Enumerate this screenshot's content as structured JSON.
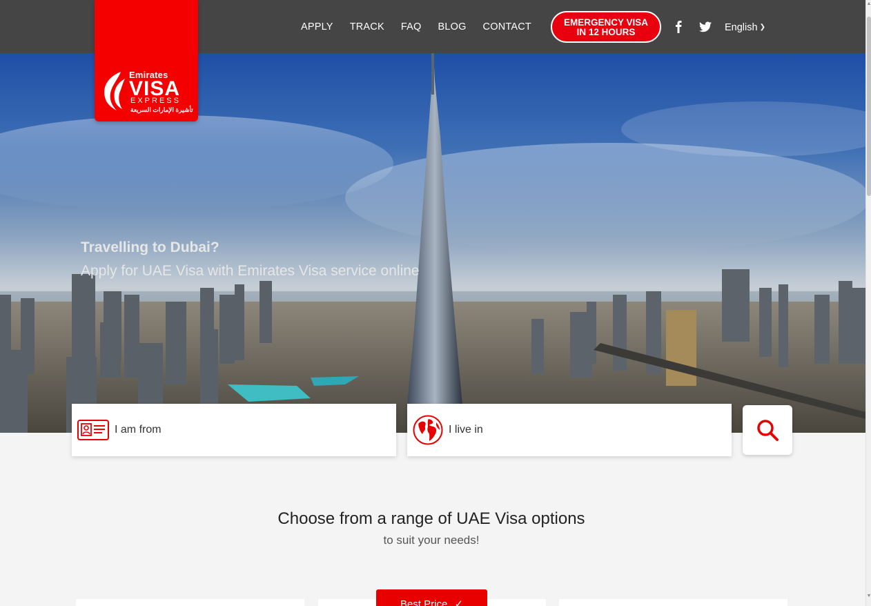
{
  "brand": {
    "logo_small": "Emirates",
    "logo_visa": "VISA",
    "logo_express": "EXPRESS",
    "logo_arabic": "تأشيرة الإمارات السريعة",
    "color": "#f40000"
  },
  "nav": {
    "items": [
      {
        "label": "APPLY"
      },
      {
        "label": "TRACK"
      },
      {
        "label": "FAQ"
      },
      {
        "label": "BLOG"
      },
      {
        "label": "CONTACT"
      }
    ],
    "emergency_line1": "EMERGENCY VISA",
    "emergency_line2": "IN 12 HOURS",
    "social": [
      "facebook-icon",
      "twitter-icon"
    ],
    "language": "English"
  },
  "hero": {
    "title": "Travelling to Dubai?",
    "subtitle": "Apply for UAE Visa with Emirates Visa service online"
  },
  "search": {
    "from_label": "I am from",
    "from_icon": "id-card-icon",
    "live_label": "I live in",
    "live_icon": "globe-icon",
    "button_icon": "search-icon"
  },
  "section": {
    "title": "Choose from a range of UAE Visa options",
    "subtitle": "to suit your needs!",
    "badge": "Best Price"
  },
  "colors": {
    "header_bg": "#454545",
    "accent": "#e80000",
    "page_bg": "#f4f4f4"
  }
}
